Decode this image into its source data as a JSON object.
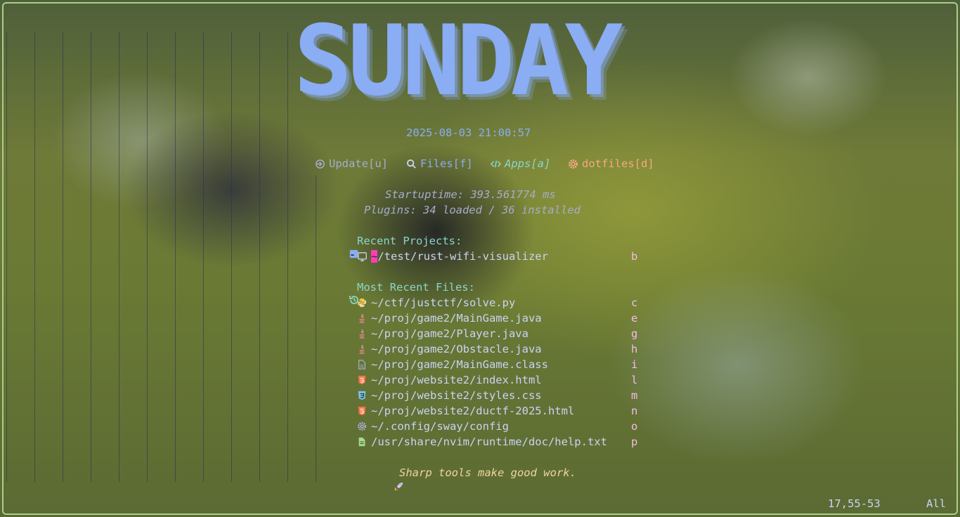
{
  "banner": "SUNDAY",
  "datetime": "2025-08-03 21:00:57",
  "buttons": [
    {
      "label": "Update[u]",
      "icon": "update-icon",
      "color": "#a5adcb"
    },
    {
      "label": "Files[f]",
      "icon": "search-icon",
      "color": "#8aadf4"
    },
    {
      "label": "Apps[a]",
      "icon": "code-icon",
      "color": "#8bd5ca"
    },
    {
      "label": "dotfiles[d]",
      "icon": "gear-icon",
      "color": "#f5a97f"
    }
  ],
  "stats": {
    "startuptime": "Startuptime: 393.561774 ms",
    "plugins": "Plugins: 34 loaded / 36 installed"
  },
  "recent_projects": {
    "title": "Recent Projects:",
    "items": [
      {
        "cursor_char": "~",
        "path": "/test/rust-wifi-visualizer",
        "key": "b",
        "icon": "terminal-icon"
      }
    ]
  },
  "recent_files": {
    "title": "Most Recent Files:",
    "items": [
      {
        "path": "~/ctf/justctf/solve.py",
        "key": "c",
        "icon": "python-icon"
      },
      {
        "path": "~/proj/game2/MainGame.java",
        "key": "e",
        "icon": "java-icon"
      },
      {
        "path": "~/proj/game2/Player.java",
        "key": "g",
        "icon": "java-icon"
      },
      {
        "path": "~/proj/game2/Obstacle.java",
        "key": "h",
        "icon": "java-icon"
      },
      {
        "path": "~/proj/game2/MainGame.class",
        "key": "i",
        "icon": "file-icon"
      },
      {
        "path": "~/proj/website2/index.html",
        "key": "l",
        "icon": "html-icon"
      },
      {
        "path": "~/proj/website2/styles.css",
        "key": "m",
        "icon": "css-icon"
      },
      {
        "path": "~/proj/website2/ductf-2025.html",
        "key": "n",
        "icon": "html-icon"
      },
      {
        "path": "~/.config/sway/config",
        "key": "o",
        "icon": "gear-icon"
      },
      {
        "path": "/usr/share/nvim/runtime/doc/help.txt",
        "key": "p",
        "icon": "text-file-icon"
      }
    ]
  },
  "quote": "Sharp tools make good work.",
  "statusline": {
    "position": "17,55-53",
    "scroll": "All"
  }
}
